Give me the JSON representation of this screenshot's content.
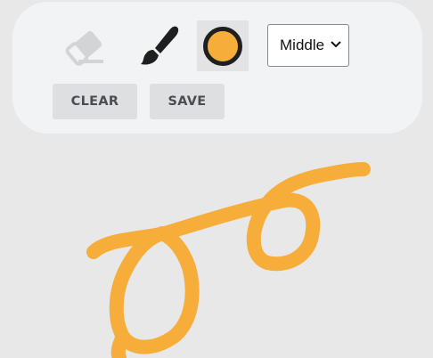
{
  "toolbar": {
    "eraser_icon": "eraser-icon",
    "brush_icon": "paint-brush-icon",
    "color": "#f6ad3a",
    "brush_size": {
      "selected": "Middle"
    },
    "clear_label": "CLEAR",
    "save_label": "SAVE"
  },
  "canvas": {
    "stroke_color": "#f6ad3a",
    "background": "#e8e8e8"
  }
}
